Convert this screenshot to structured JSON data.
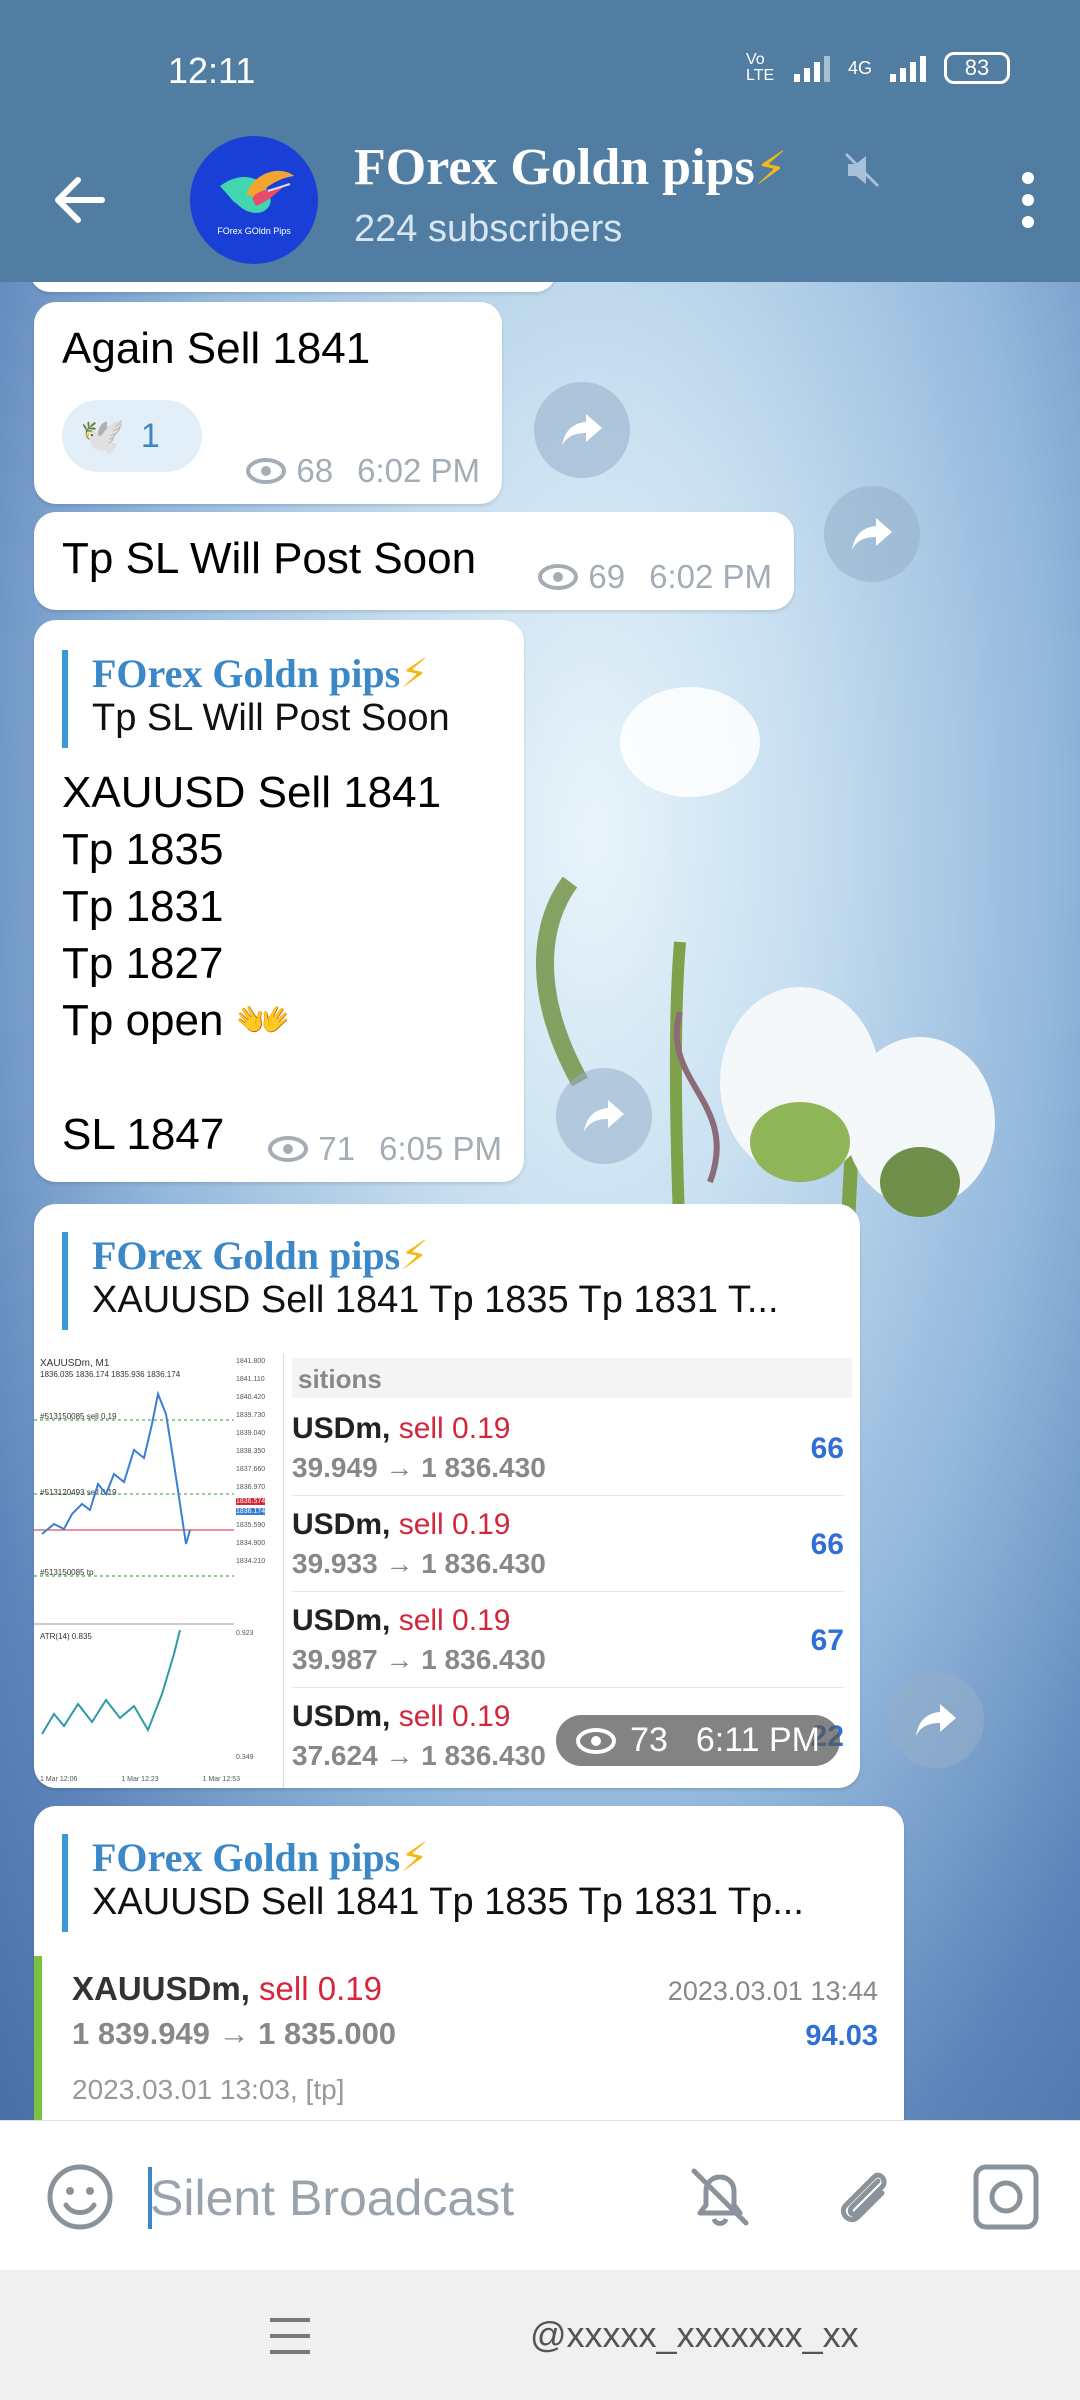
{
  "status": {
    "time": "12:11",
    "network": "4G",
    "volte": "Vo LTE",
    "battery": "83"
  },
  "header": {
    "title": "FOrex Goldn pips",
    "title_emoji": "⚡",
    "subscribers": "224 subscribers",
    "avatar_caption": "FOrex GOldn Pips"
  },
  "messages": [
    {
      "text": "Again Sell 1841",
      "reaction_emoji": "🕊️",
      "reaction_count": "1",
      "views": "68",
      "time": "6:02 PM"
    },
    {
      "text": "Tp SL Will Post Soon",
      "views": "69",
      "time": "6:02 PM"
    },
    {
      "reply_author": "FOrex Goldn pips",
      "reply_text": "Tp SL Will Post Soon",
      "lines": [
        "XAUUSD Sell 1841",
        "Tp 1835",
        "Tp 1831",
        "Tp 1827",
        "Tp open 👐",
        "",
        "SL 1847"
      ],
      "views": "71",
      "time": "6:05 PM"
    },
    {
      "reply_author": "FOrex Goldn pips",
      "reply_text": "XAUUSD Sell 1841 Tp 1835 Tp 1831 T...",
      "chart_title": "XAUUSDm, M1",
      "chart_ohlc": "1836.035 1836.174 1835.936 1836.174",
      "chart_labels": [
        "#513150085 sell 0.19",
        "#513120493 sell 0.19",
        "#513150085 tp"
      ],
      "chart_prices": [
        "1841.800",
        "1841.110",
        "1840.420",
        "1839.730",
        "1839.040",
        "1838.350",
        "1837.660",
        "1836.970",
        "1836.574",
        "1835.590",
        "1834.900",
        "1834.210",
        "0.923",
        "0.349"
      ],
      "chart_price_tags": [
        "1836.574",
        "1836.174"
      ],
      "atr_label": "ATR(14) 0.835",
      "chart_times": [
        "1 Mar 12:06",
        "1 Mar 12:23",
        "1 Mar 12:53"
      ],
      "positions_header": "sitions",
      "positions": [
        {
          "symbol": "USDm,",
          "side": "sell 0.19",
          "prices": "39.949 → 1 836.430",
          "profit": "66"
        },
        {
          "symbol": "USDm,",
          "side": "sell 0.19",
          "prices": "39.933 → 1 836.430",
          "profit": "66"
        },
        {
          "symbol": "USDm,",
          "side": "sell 0.19",
          "prices": "39.987 → 1 836.430",
          "profit": "67"
        },
        {
          "symbol": "USDm,",
          "side": "sell 0.19",
          "prices": "37.624 → 1 836.430",
          "profit": "22"
        }
      ],
      "views": "73",
      "time": "6:11 PM"
    },
    {
      "reply_author": "FOrex Goldn pips",
      "reply_text": "XAUUSD Sell 1841 Tp 1835 Tp 1831 Tp...",
      "position": {
        "symbol": "XAUUSDm,",
        "side": "sell 0.19",
        "date": "2023.03.01 13:44",
        "prices": "1 839.949 → 1 835.000",
        "profit": "94.03",
        "open_info": "2023.03.01 13:03, [tp]"
      }
    }
  ],
  "input": {
    "placeholder": "Silent Broadcast"
  },
  "navbar": {
    "watermark": "@xxxxx_xxxxxxx_xx"
  },
  "colors": {
    "header": "#517da2",
    "accent": "#3a88c8",
    "bolt": "#f6b71b",
    "sell": "#d6263b",
    "profit": "#2f6fd6"
  }
}
